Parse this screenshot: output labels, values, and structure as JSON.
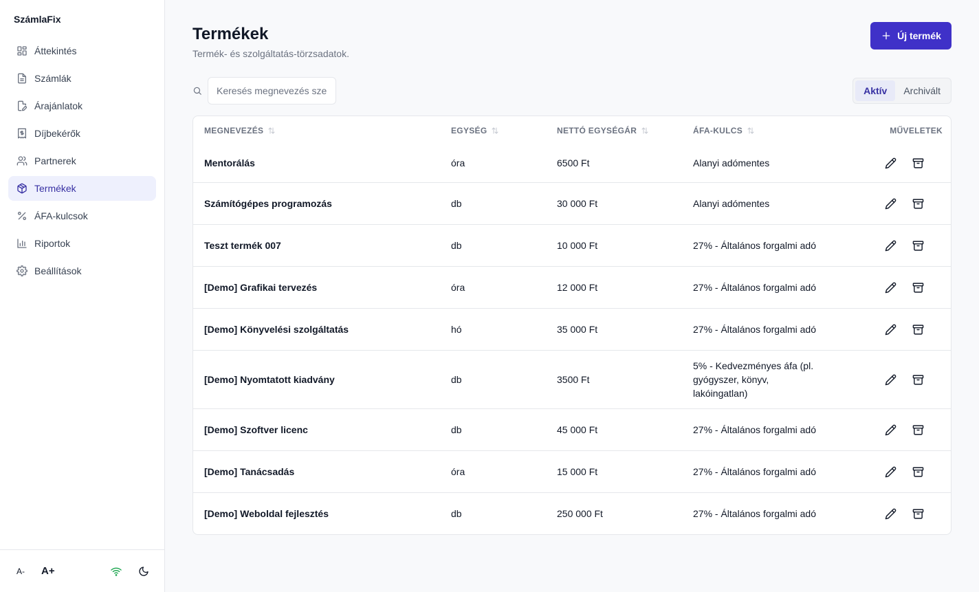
{
  "app": {
    "name": "SzámlaFix"
  },
  "sidebar": {
    "items": [
      {
        "label": "Áttekintés",
        "icon": "dashboard-icon",
        "active": false
      },
      {
        "label": "Számlák",
        "icon": "file-text-icon",
        "active": false
      },
      {
        "label": "Árajánlatok",
        "icon": "file-edit-icon",
        "active": false
      },
      {
        "label": "Díjbekérők",
        "icon": "receipt-dollar-icon",
        "active": false
      },
      {
        "label": "Partnerek",
        "icon": "users-icon",
        "active": false
      },
      {
        "label": "Termékek",
        "icon": "package-icon",
        "active": true
      },
      {
        "label": "ÁFA-kulcsok",
        "icon": "percent-icon",
        "active": false
      },
      {
        "label": "Riportok",
        "icon": "bar-chart-icon",
        "active": false
      },
      {
        "label": "Beállítások",
        "icon": "gear-icon",
        "active": false
      }
    ],
    "footer": {
      "font_decrease": "A-",
      "font_increase": "A+",
      "status_color": "#16a34a"
    }
  },
  "header": {
    "title": "Termékek",
    "subtitle": "Termék- és szolgáltatás-törzsadatok.",
    "new_button": "Új termék"
  },
  "search": {
    "placeholder": "Keresés megnevezés szerint..."
  },
  "filter": {
    "options": [
      "Aktív",
      "Archivált"
    ],
    "selected": "Aktív"
  },
  "table": {
    "columns": [
      "MEGNEVEZÉS",
      "EGYSÉG",
      "NETTÓ EGYSÉGÁR",
      "ÁFA-KULCS",
      "MŰVELETEK"
    ],
    "rows": [
      {
        "name": "Mentorálás",
        "unit": "óra",
        "price": "6500 Ft",
        "vat": "Alanyi adómentes"
      },
      {
        "name": "Számítógépes programozás",
        "unit": "db",
        "price": "30 000 Ft",
        "vat": "Alanyi adómentes"
      },
      {
        "name": "Teszt termék 007",
        "unit": "db",
        "price": "10 000 Ft",
        "vat": "27% - Általános forgalmi adó"
      },
      {
        "name": "[Demo] Grafikai tervezés",
        "unit": "óra",
        "price": "12 000 Ft",
        "vat": "27% - Általános forgalmi adó"
      },
      {
        "name": "[Demo] Könyvelési szolgáltatás",
        "unit": "hó",
        "price": "35 000 Ft",
        "vat": "27% - Általános forgalmi adó"
      },
      {
        "name": "[Demo] Nyomtatott kiadvány",
        "unit": "db",
        "price": "3500 Ft",
        "vat": "5% - Kedvezményes áfa (pl. gyógyszer, könyv, lakóingatlan)"
      },
      {
        "name": "[Demo] Szoftver licenc",
        "unit": "db",
        "price": "45 000 Ft",
        "vat": "27% - Általános forgalmi adó"
      },
      {
        "name": "[Demo] Tanácsadás",
        "unit": "óra",
        "price": "15 000 Ft",
        "vat": "27% - Általános forgalmi adó"
      },
      {
        "name": "[Demo] Weboldal fejlesztés",
        "unit": "db",
        "price": "250 000 Ft",
        "vat": "27% - Általános forgalmi adó"
      }
    ]
  },
  "colors": {
    "accent": "#3f31c8",
    "active_bg": "#eef0fd",
    "active_text": "#3730a3"
  }
}
